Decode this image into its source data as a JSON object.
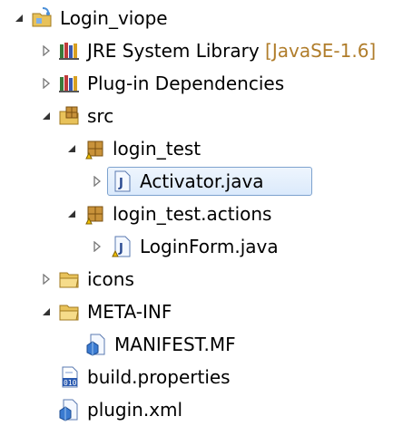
{
  "tree": {
    "project": {
      "label": "Login_viope",
      "expanded": true
    },
    "jre": {
      "label": "JRE System Library",
      "decoration": "[JavaSE-1.6]",
      "expanded": false
    },
    "plugin_deps": {
      "label": "Plug-in Dependencies",
      "expanded": false
    },
    "src": {
      "label": "src",
      "expanded": true
    },
    "pkg_login_test": {
      "label": "login_test",
      "expanded": true
    },
    "activator": {
      "label": "Activator.java",
      "selected": true,
      "expanded": false
    },
    "pkg_actions": {
      "label": "login_test.actions",
      "expanded": true
    },
    "loginform": {
      "label": "LoginForm.java",
      "expanded": false
    },
    "icons_folder": {
      "label": "icons",
      "expanded": false
    },
    "metainf": {
      "label": "META-INF",
      "expanded": true
    },
    "manifest": {
      "label": "MANIFEST.MF"
    },
    "build_props": {
      "label": "build.properties"
    },
    "plugin_xml": {
      "label": "plugin.xml"
    }
  },
  "icons": {
    "project": "plugin-project-icon",
    "library": "library-icon",
    "source_folder": "source-folder-icon",
    "package": "package-icon",
    "java_file": "java-file-icon",
    "folder": "folder-icon",
    "manifest_file": "manifest-file-icon",
    "properties_file": "properties-file-icon"
  },
  "colors": {
    "selection_border": "#7da2ce",
    "selection_fill": "#dbeafc",
    "decoration_text": "#b07d2b",
    "folder": "#e8c25a",
    "package": "#c8923a",
    "library_books": "#3a7a3a"
  }
}
